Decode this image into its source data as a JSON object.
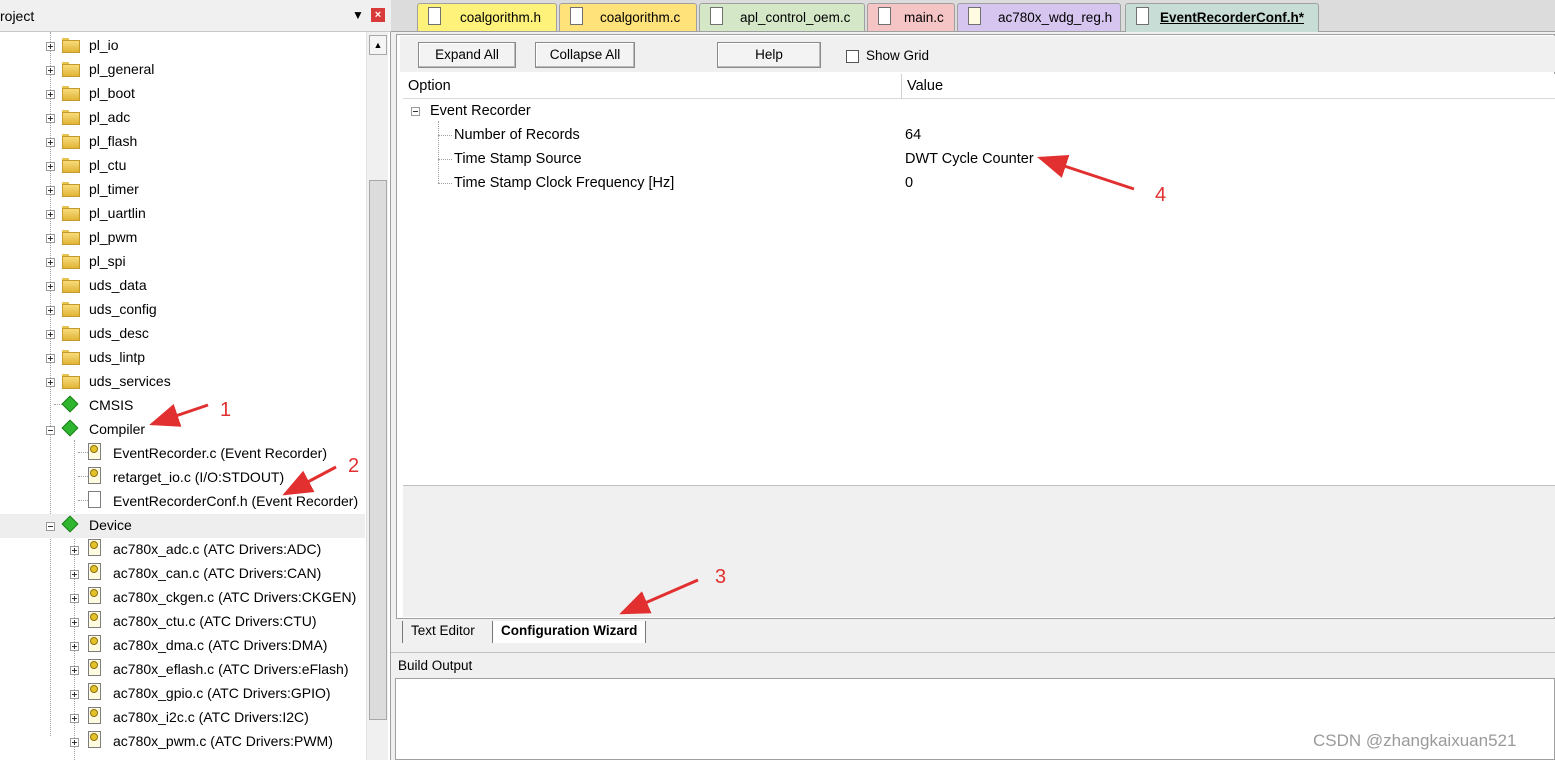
{
  "project_panel": {
    "title": "roject",
    "pin_icon": "pin-icon",
    "close_icon": "close-icon",
    "tree": [
      {
        "label": "pl_io",
        "icon": "folder-icon"
      },
      {
        "label": "pl_general",
        "icon": "folder-icon"
      },
      {
        "label": "pl_boot",
        "icon": "folder-icon"
      },
      {
        "label": "pl_adc",
        "icon": "folder-icon"
      },
      {
        "label": "pl_flash",
        "icon": "folder-icon"
      },
      {
        "label": "pl_ctu",
        "icon": "folder-icon"
      },
      {
        "label": "pl_timer",
        "icon": "folder-icon"
      },
      {
        "label": "pl_uartlin",
        "icon": "folder-icon"
      },
      {
        "label": "pl_pwm",
        "icon": "folder-icon"
      },
      {
        "label": "pl_spi",
        "icon": "folder-icon"
      },
      {
        "label": "uds_data",
        "icon": "folder-icon"
      },
      {
        "label": "uds_config",
        "icon": "folder-icon"
      },
      {
        "label": "uds_desc",
        "icon": "folder-icon"
      },
      {
        "label": "uds_lintp",
        "icon": "folder-icon"
      },
      {
        "label": "uds_services",
        "icon": "folder-icon"
      },
      {
        "label": "CMSIS",
        "icon": "component-icon"
      },
      {
        "label": "Compiler",
        "icon": "component-icon"
      },
      {
        "label": "EventRecorder.c (Event Recorder)",
        "icon": "config-file-icon"
      },
      {
        "label": "retarget_io.c (I/O:STDOUT)",
        "icon": "config-file-icon"
      },
      {
        "label": "EventRecorderConf.h (Event Recorder)",
        "icon": "file-icon"
      },
      {
        "label": "Device",
        "icon": "component-icon"
      },
      {
        "label": "ac780x_adc.c (ATC Drivers:ADC)",
        "icon": "config-file-icon"
      },
      {
        "label": "ac780x_can.c (ATC Drivers:CAN)",
        "icon": "config-file-icon"
      },
      {
        "label": "ac780x_ckgen.c (ATC Drivers:CKGEN)",
        "icon": "config-file-icon"
      },
      {
        "label": "ac780x_ctu.c (ATC Drivers:CTU)",
        "icon": "config-file-icon"
      },
      {
        "label": "ac780x_dma.c (ATC Drivers:DMA)",
        "icon": "config-file-icon"
      },
      {
        "label": "ac780x_eflash.c (ATC Drivers:eFlash)",
        "icon": "config-file-icon"
      },
      {
        "label": "ac780x_gpio.c (ATC Drivers:GPIO)",
        "icon": "config-file-icon"
      },
      {
        "label": "ac780x_i2c.c (ATC Drivers:I2C)",
        "icon": "config-file-icon"
      },
      {
        "label": "ac780x_pwm.c (ATC Drivers:PWM)",
        "icon": "config-file-icon"
      }
    ]
  },
  "editor_tabs": [
    {
      "label": "coalgorithm.h",
      "color": "#fff27a"
    },
    {
      "label": "coalgorithm.c",
      "color": "#ffe27a"
    },
    {
      "label": "apl_control_oem.c",
      "color": "#d4e8c8"
    },
    {
      "label": "main.c",
      "color": "#f5c4c4"
    },
    {
      "label": "ac780x_wdg_reg.h",
      "color": "#d6c6ef"
    },
    {
      "label": "EventRecorderConf.h*",
      "color": "#c8ddd6"
    }
  ],
  "toolbar": {
    "expand_all": "Expand All",
    "collapse_all": "Collapse All",
    "help": "Help",
    "show_grid": "Show Grid"
  },
  "grid": {
    "col_option": "Option",
    "col_value": "Value",
    "group": "Event Recorder",
    "rows": [
      {
        "option": "Number of Records",
        "value": "64"
      },
      {
        "option": "Time Stamp Source",
        "value": "DWT Cycle Counter"
      },
      {
        "option": "Time Stamp Clock Frequency [Hz]",
        "value": "0"
      }
    ]
  },
  "bottom_tabs": {
    "text_editor": "Text Editor",
    "config_wizard": "Configuration Wizard"
  },
  "build_output": {
    "title": "Build Output"
  },
  "watermark": "CSDN @zhangkaixuan521",
  "annotations": [
    "1",
    "2",
    "3",
    "4"
  ],
  "colors": {
    "annotation_red": "#e23030",
    "component_green": "#2fb52f"
  }
}
